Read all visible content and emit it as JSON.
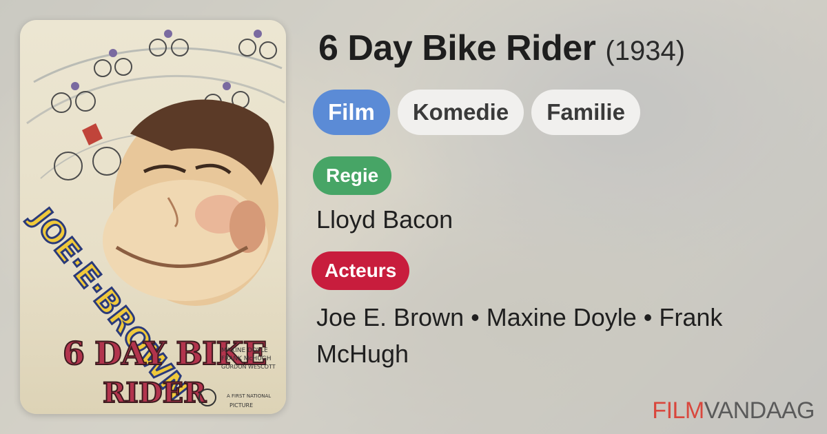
{
  "movie": {
    "title": "6 Day Bike Rider",
    "year": "(1934)"
  },
  "poster": {
    "star": "JOE·E·BROWN",
    "headline_1": "6 DAY BIKE",
    "headline_2": "RIDER",
    "cast_credit_1": "MAXINE DOYLE",
    "cast_credit_2": "FRANK McHUGH",
    "cast_credit_3": "GORDON WESCOTT",
    "studio_1": "A FIRST NATIONAL",
    "studio_2": "PICTURE"
  },
  "tags": {
    "type": "Film",
    "genres": [
      "Komedie",
      "Familie"
    ]
  },
  "director": {
    "label": "Regie",
    "name": "Lloyd Bacon"
  },
  "cast": {
    "label": "Acteurs",
    "names": "Joe E. Brown • Maxine Doyle • Frank McHugh"
  },
  "brand": {
    "part1": "FILM",
    "part2": "VANDAAG"
  },
  "colors": {
    "type_chip": "#5b8bd6",
    "director_label": "#47a566",
    "cast_label": "#c81d3d",
    "brand_accent": "#d9473d"
  }
}
